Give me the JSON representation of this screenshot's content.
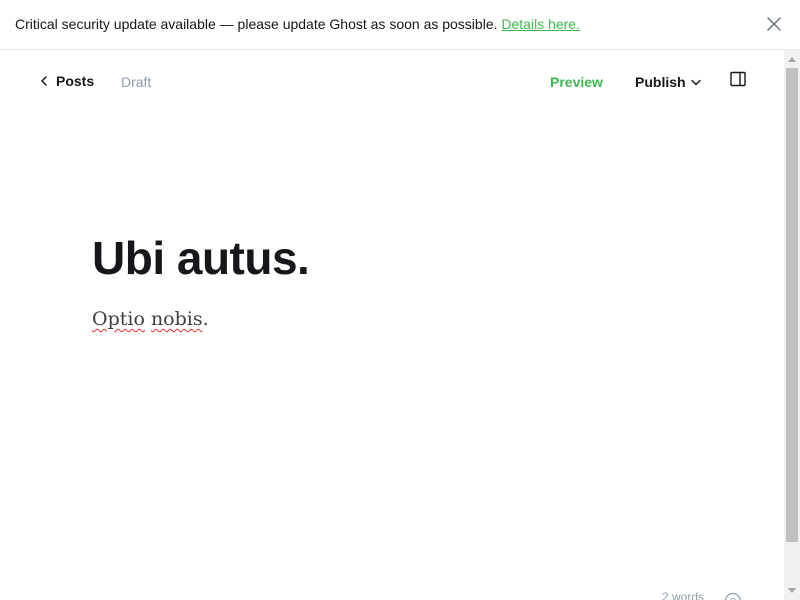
{
  "banner": {
    "message": "Critical security update available — please update Ghost as soon as possible. ",
    "link_text": "Details here.",
    "close_icon": "close-icon"
  },
  "header": {
    "back_label": "Posts",
    "back_icon": "chevron-left-icon",
    "status": "Draft",
    "preview_label": "Preview",
    "publish_label": "Publish",
    "publish_icon": "chevron-down-icon",
    "sidebar_icon": "sidebar-toggle-icon"
  },
  "post": {
    "title": "Ubi autus.",
    "body_word1": "Optio",
    "body_word2": "nobis",
    "body_end": "."
  },
  "footer": {
    "word_count": "2 words",
    "help_icon": "help-icon"
  },
  "colors": {
    "accent": "#3eb94f",
    "text": "#15171a",
    "muted": "#8e9cac"
  }
}
